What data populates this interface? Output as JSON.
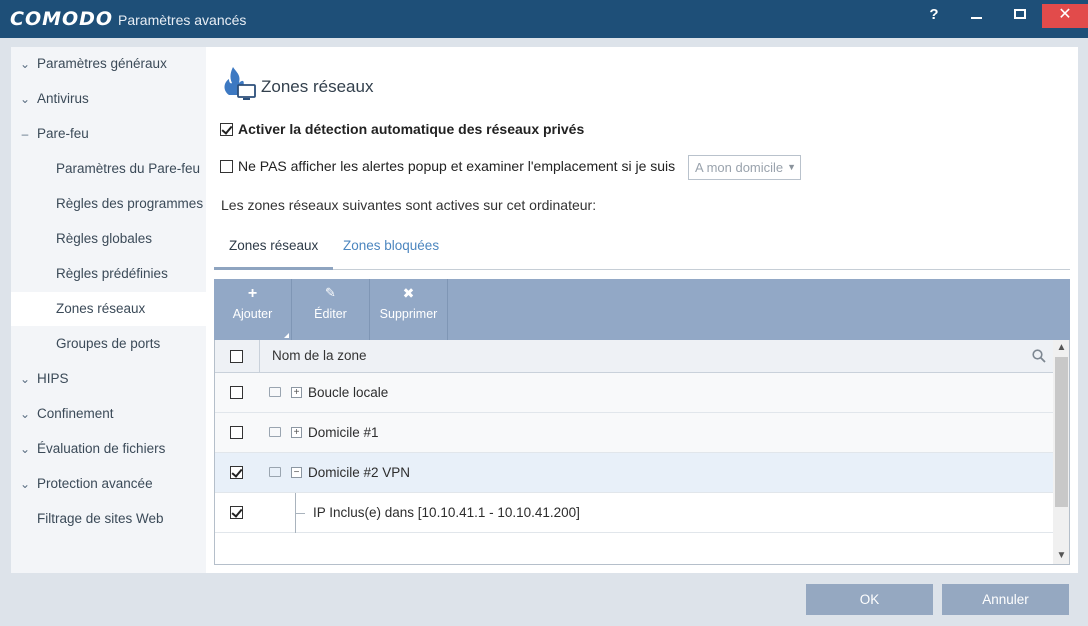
{
  "window": {
    "logo": "COMODO",
    "title": "Paramètres avancés",
    "help": "?",
    "close": "✕"
  },
  "sidebar": {
    "items": [
      {
        "label": "Paramètres généraux",
        "icon": "chevron-down-icon"
      },
      {
        "label": "Antivirus",
        "icon": "chevron-down-icon"
      },
      {
        "label": "Pare-feu",
        "icon": "minus-icon"
      },
      {
        "label": "Paramètres du Pare-feu"
      },
      {
        "label": "Règles des programmes"
      },
      {
        "label": "Règles globales"
      },
      {
        "label": "Règles prédéfinies"
      },
      {
        "label": "Zones réseaux",
        "active": true
      },
      {
        "label": "Groupes de ports"
      },
      {
        "label": "HIPS",
        "icon": "chevron-down-icon"
      },
      {
        "label": "Confinement",
        "icon": "chevron-down-icon"
      },
      {
        "label": "Évaluation de fichiers",
        "icon": "chevron-down-icon"
      },
      {
        "label": "Protection avancée",
        "icon": "chevron-down-icon"
      },
      {
        "label": "Filtrage de sites Web"
      }
    ]
  },
  "page": {
    "title": "Zones réseaux",
    "icon": "network-zone-icon",
    "option_auto_detect": {
      "label": "Activer la détection automatique des réseaux privés",
      "checked": true
    },
    "option_no_popup": {
      "label": "Ne PAS afficher les alertes popup et examiner l'emplacement si je suis",
      "checked": false
    },
    "location_select": {
      "value": "A mon domicile"
    },
    "info_text": "Les zones réseaux suivantes sont actives sur cet ordinateur:"
  },
  "tabs": [
    {
      "label": "Zones réseaux",
      "active": true
    },
    {
      "label": "Zones bloquées",
      "active": false
    }
  ],
  "toolbar": {
    "add": {
      "label": "Ajouter",
      "icon": "plus-icon"
    },
    "edit": {
      "label": "Éditer",
      "icon": "pencil-icon"
    },
    "delete": {
      "label": "Supprimer",
      "icon": "x-icon"
    }
  },
  "grid": {
    "column_header": "Nom de la zone",
    "rows": [
      {
        "label": "Boucle locale",
        "checked": false,
        "expander": "+"
      },
      {
        "label": "Domicile #1",
        "checked": false,
        "expander": "+"
      },
      {
        "label": "Domicile #2 VPN",
        "checked": true,
        "expander": "−",
        "selected": true
      },
      {
        "label": "IP Inclus(e) dans [10.10.41.1 - 10.10.41.200]",
        "checked": true,
        "child": true
      }
    ]
  },
  "footer": {
    "ok": "OK",
    "cancel": "Annuler"
  },
  "colors": {
    "titlebar": "#1e4f78",
    "toolbar": "#92a8c6",
    "buttons": "#95a8c1",
    "close": "#e24b4b",
    "link": "#4c86bf"
  }
}
